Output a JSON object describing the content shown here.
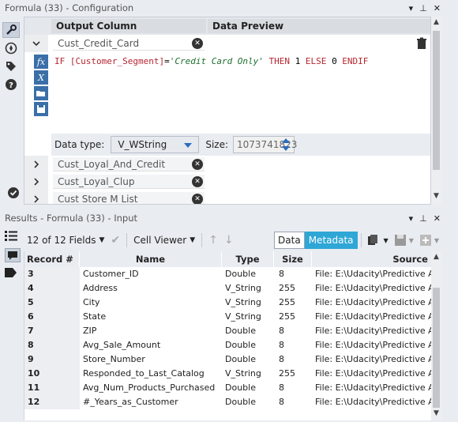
{
  "config": {
    "title": "Formula (33) - Configuration",
    "col_output": "Output Column",
    "col_preview": "Data Preview",
    "active_field": "Cust_Credit_Card",
    "expression": {
      "t1": "IF ",
      "t2": "[Customer_Segment]",
      "t3": "=",
      "t4": "'Credit Card Only'",
      "t5": " THEN ",
      "t6": "1",
      "t7": " ELSE ",
      "t8": "0",
      "t9": " ENDIF"
    },
    "data_type_label": "Data type:",
    "data_type_value": "V_WString",
    "size_label": "Size:",
    "size_value": "1073741823",
    "rows": [
      {
        "label": "Cust_Loyal_And_Credit"
      },
      {
        "label": "Cust_Loyal_Clup"
      },
      {
        "label": "Cust Store M List"
      }
    ]
  },
  "results": {
    "title": "Results - Formula (33) - Input",
    "fields_count": "12 of 12 Fields",
    "cell_viewer": "Cell Viewer",
    "data_btn": "Data",
    "metadata_btn": "Metadata",
    "headers": {
      "record": "Record #",
      "name": "Name",
      "type": "Type",
      "size": "Size",
      "source": "Source"
    },
    "rows": [
      {
        "rec": "3",
        "name": "Customer_ID",
        "type": "Double",
        "size": "8",
        "source": "File: E:\\Udacity\\Predictive Ana"
      },
      {
        "rec": "4",
        "name": "Address",
        "type": "V_String",
        "size": "255",
        "source": "File: E:\\Udacity\\Predictive Ana"
      },
      {
        "rec": "5",
        "name": "City",
        "type": "V_String",
        "size": "255",
        "source": "File: E:\\Udacity\\Predictive Ana"
      },
      {
        "rec": "6",
        "name": "State",
        "type": "V_String",
        "size": "255",
        "source": "File: E:\\Udacity\\Predictive Ana"
      },
      {
        "rec": "7",
        "name": "ZIP",
        "type": "Double",
        "size": "8",
        "source": "File: E:\\Udacity\\Predictive Ana"
      },
      {
        "rec": "8",
        "name": "Avg_Sale_Amount",
        "type": "Double",
        "size": "8",
        "source": "File: E:\\Udacity\\Predictive Ana"
      },
      {
        "rec": "9",
        "name": "Store_Number",
        "type": "Double",
        "size": "8",
        "source": "File: E:\\Udacity\\Predictive Ana"
      },
      {
        "rec": "10",
        "name": "Responded_to_Last_Catalog",
        "type": "V_String",
        "size": "255",
        "source": "File: E:\\Udacity\\Predictive Ana"
      },
      {
        "rec": "11",
        "name": "Avg_Num_Products_Purchased",
        "type": "Double",
        "size": "8",
        "source": "File: E:\\Udacity\\Predictive Ana"
      },
      {
        "rec": "12",
        "name": "#_Years_as_Customer",
        "type": "Double",
        "size": "8",
        "source": "File: E:\\Udacity\\Predictive Ana"
      }
    ]
  },
  "colors": {
    "accent": "#2ea7d6",
    "keyword": "#b6262f",
    "string": "#1f6f2e",
    "icon_blue": "#3a6fa8"
  }
}
